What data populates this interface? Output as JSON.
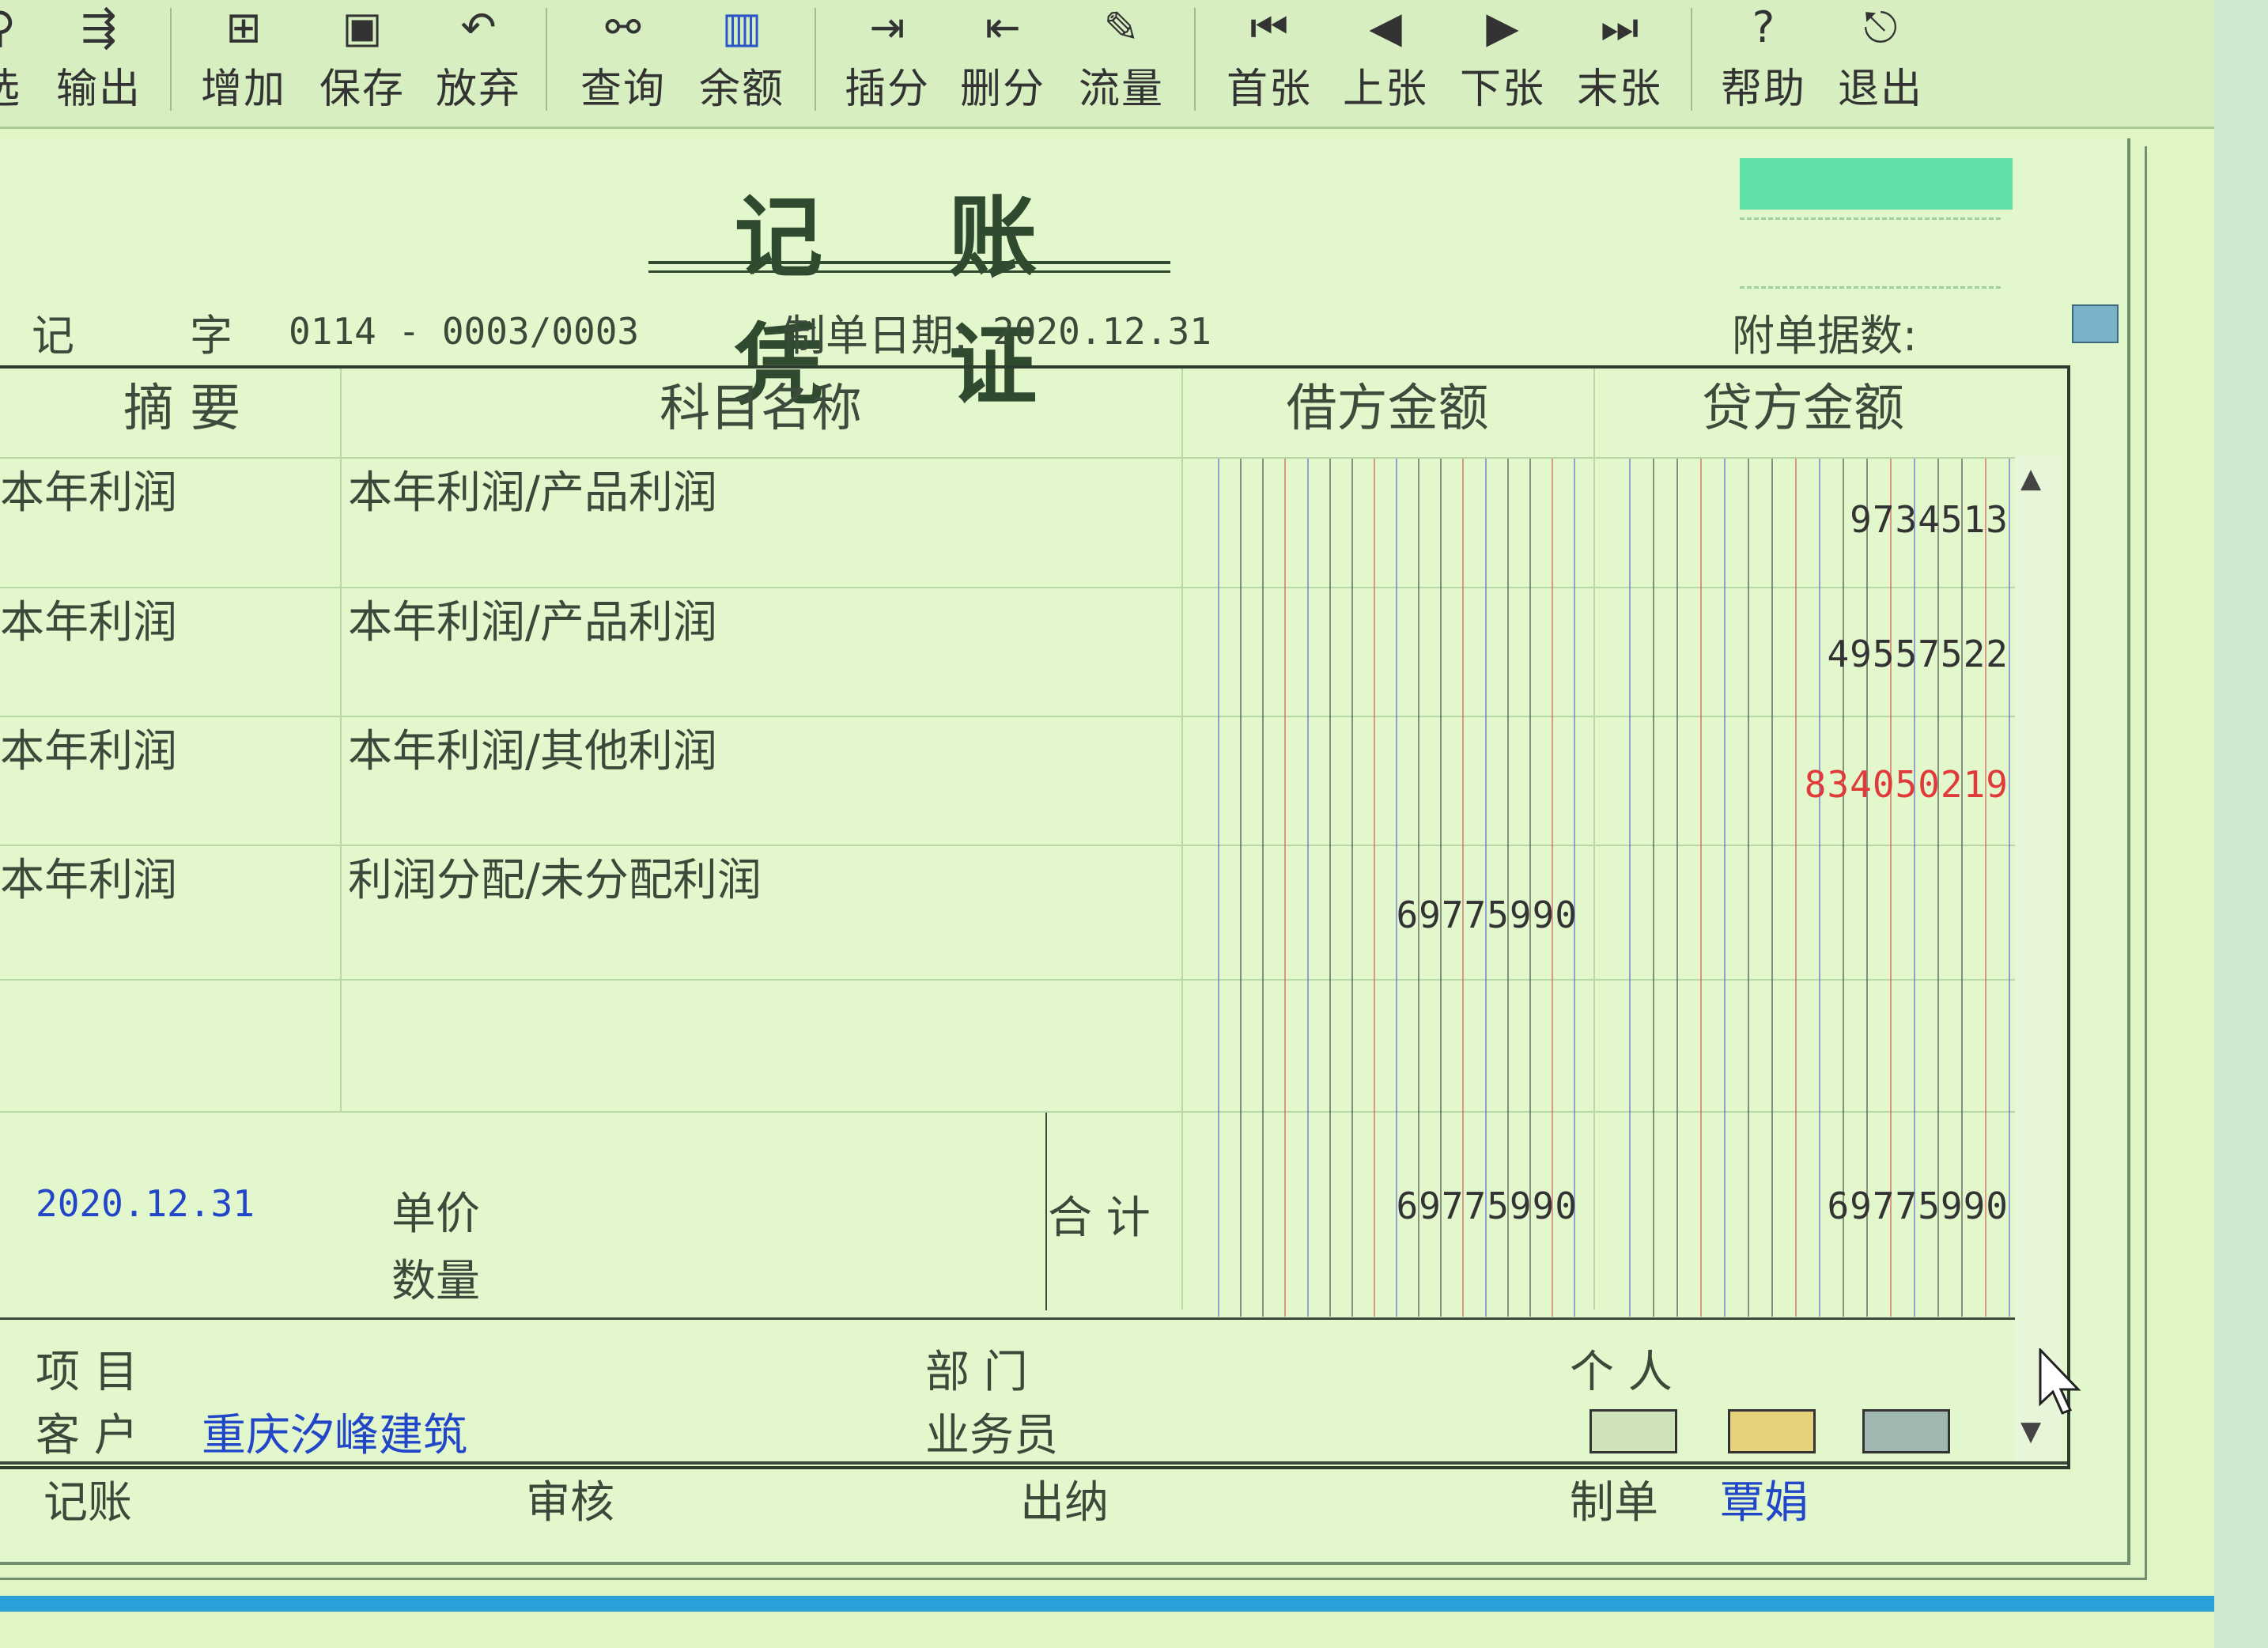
{
  "toolbar": {
    "buttons": [
      {
        "label": "选",
        "icon": "filter-icon"
      },
      {
        "label": "输出",
        "icon": "export-icon"
      },
      {
        "label": "增加",
        "icon": "add-icon"
      },
      {
        "label": "保存",
        "icon": "save-icon"
      },
      {
        "label": "放弃",
        "icon": "undo-icon"
      },
      {
        "label": "查询",
        "icon": "binoculars-icon"
      },
      {
        "label": "余额",
        "icon": "bar-chart-icon"
      },
      {
        "label": "插分",
        "icon": "insert-row-icon"
      },
      {
        "label": "删分",
        "icon": "delete-row-icon"
      },
      {
        "label": "流量",
        "icon": "pencil-icon"
      },
      {
        "label": "首张",
        "icon": "first-icon"
      },
      {
        "label": "上张",
        "icon": "previous-icon"
      },
      {
        "label": "下张",
        "icon": "next-icon"
      },
      {
        "label": "末张",
        "icon": "last-icon"
      },
      {
        "label": "帮助",
        "icon": "help-icon"
      },
      {
        "label": "退出",
        "icon": "exit-icon"
      }
    ]
  },
  "voucher": {
    "title": "记 账 凭 证",
    "type_label": "记",
    "type_suffix": "字",
    "number": "0114 - 0003/0003",
    "date_label": "制单日期:",
    "date_value": "2020.12.31",
    "attachments_label": "附单据数:"
  },
  "table": {
    "headers": {
      "summary": "摘 要",
      "account": "科目名称",
      "debit": "借方金额",
      "credit": "贷方金额"
    },
    "rows": [
      {
        "summary": "本年利润",
        "account": "本年利润/产品利润",
        "debit": "",
        "credit": "9734513",
        "credit_negative": false
      },
      {
        "summary": "本年利润",
        "account": "本年利润/产品利润",
        "debit": "",
        "credit": "49557522",
        "credit_negative": false
      },
      {
        "summary": "本年利润",
        "account": "本年利润/其他利润",
        "debit": "",
        "credit": "834050219",
        "credit_negative": true
      },
      {
        "summary": "本年利润",
        "account": "利润分配/未分配利润",
        "debit": "69775990",
        "credit": "",
        "credit_negative": false
      },
      {
        "summary": "",
        "account": "",
        "debit": "",
        "credit": "",
        "credit_negative": false
      }
    ],
    "footer": {
      "date": "2020.12.31",
      "unit_price_label": "单价",
      "quantity_label": "数量",
      "total_label": "合 计",
      "total_debit": "69775990",
      "total_credit": "69775990"
    }
  },
  "aux": {
    "project_label": "项  目",
    "department_label": "部  门",
    "person_label": "个  人",
    "customer_label": "客  户",
    "customer_value": "重庆汐峰建筑",
    "salesperson_label": "业务员"
  },
  "signatures": {
    "bookkeeping_label": "记账",
    "review_label": "审核",
    "cashier_label": "出纳",
    "preparer_label": "制单",
    "preparer_value": "覃娟"
  },
  "colors": {
    "background": "#dff5c4",
    "credit_negative": "#e03a3a",
    "preparer_name": "#2246c8",
    "status_box": "#5fe0a8"
  }
}
